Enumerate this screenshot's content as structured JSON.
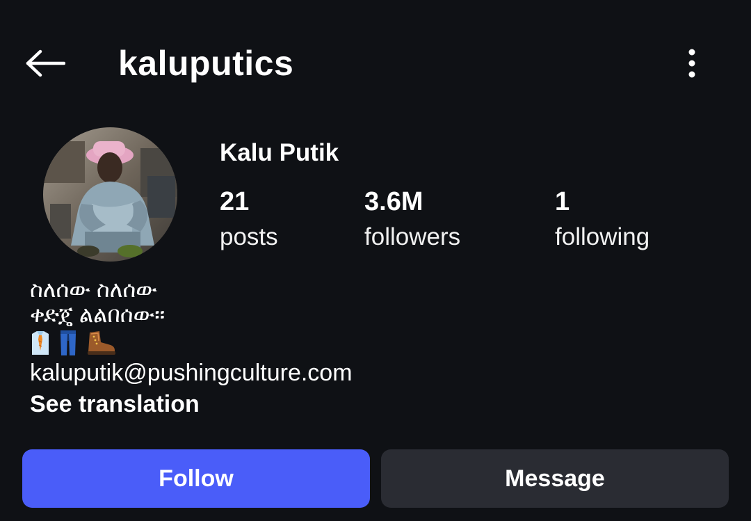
{
  "header": {
    "username": "kaluputics",
    "back_icon": "arrow-left-icon",
    "more_icon": "more-vertical-icon"
  },
  "profile": {
    "display_name": "Kalu Putik",
    "avatar_alt": "profile photo"
  },
  "stats": [
    {
      "value": "21",
      "label": "posts"
    },
    {
      "value": "3.6M",
      "label": "followers"
    },
    {
      "value": "1",
      "label": "following"
    }
  ],
  "bio": {
    "line1": "ስለሰው ስለሰው",
    "line2": "ቀድጄ ልልበሰው።",
    "emojis": [
      "shirt-tie-icon",
      "jeans-icon",
      "hiking-boot-icon"
    ],
    "link": "kaluputik@pushingculture.com",
    "see_translation": "See translation"
  },
  "actions": {
    "follow_label": "Follow",
    "message_label": "Message"
  },
  "colors": {
    "background": "#0f1115",
    "follow_button": "#4a5df9",
    "message_button": "#2a2c33",
    "text": "#ffffff"
  }
}
